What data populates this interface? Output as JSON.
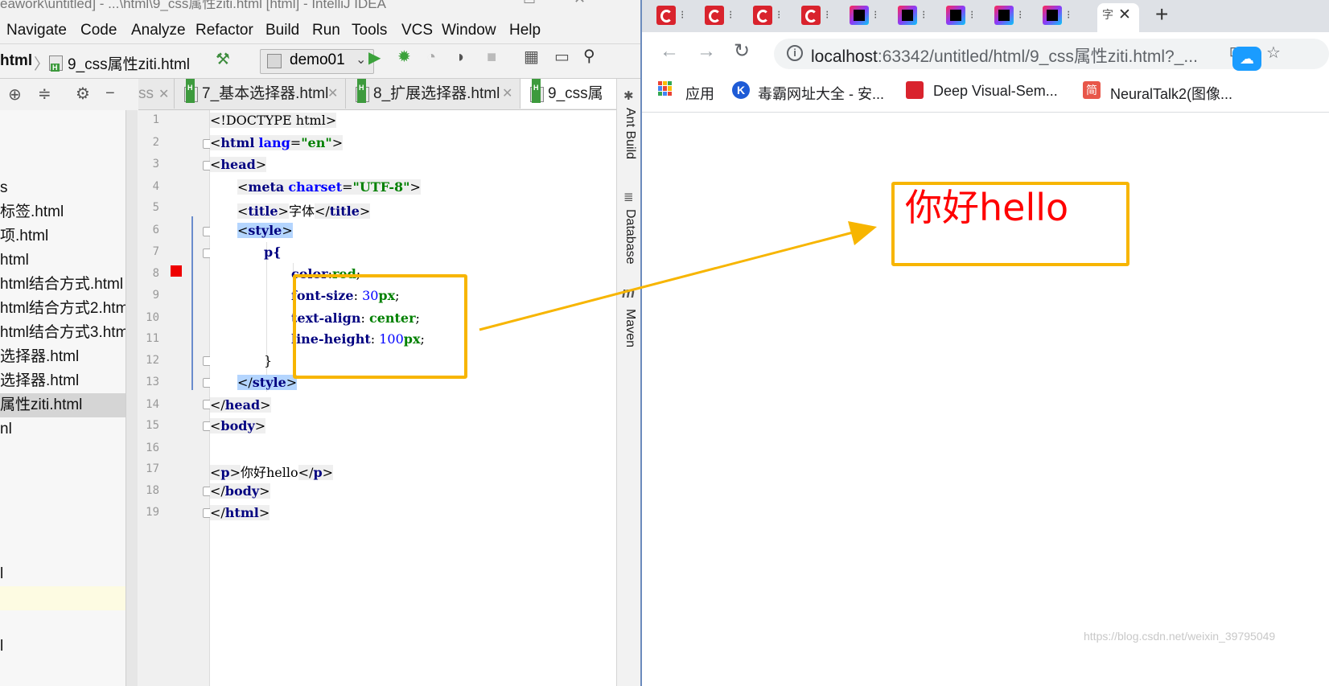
{
  "ide": {
    "title": "eawork\\untitled] - ...\\html\\9_css属性ziti.html [html] - IntelliJ IDEA",
    "menu": [
      "Navigate",
      "Code",
      "Analyze",
      "Refactor",
      "Build",
      "Run",
      "Tools",
      "VCS",
      "Window",
      "Help"
    ],
    "breadcrumb_root": "html",
    "breadcrumb_file": "9_css属性ziti.html",
    "run_config": "demo01",
    "project_items": [
      "s",
      "标签.html",
      "项.html",
      "html",
      "html结合方式.html",
      "html结合方式2.html",
      "html结合方式3.html",
      "选择器.html",
      "选择器.html",
      "属性ziti.html",
      "nl",
      "l",
      "l"
    ],
    "tabs": [
      {
        "label": "ss",
        "partial": true
      },
      {
        "label": "7_基本选择器.html"
      },
      {
        "label": "8_扩展选择器.html"
      },
      {
        "label": "9_css属"
      }
    ],
    "side_tools": [
      "Ant Build",
      "Database",
      "Maven"
    ],
    "line_numbers": [
      "1",
      "2",
      "3",
      "4",
      "5",
      "6",
      "7",
      "8",
      "9",
      "10",
      "11",
      "12",
      "13",
      "14",
      "15",
      "16",
      "17",
      "18",
      "19"
    ],
    "code": {
      "l1": "<!DOCTYPE html>",
      "l2_tag": "html",
      "l2_attr": "lang",
      "l2_val": "\"en\"",
      "l3_tag": "head",
      "l4_tag": "meta",
      "l4_attr": "charset",
      "l4_val": "\"UTF-8\"",
      "l5_tag": "title",
      "l5_text": "字体",
      "l6_tag": "style",
      "l7_sel": "p{",
      "l8_prop": "color",
      "l8_val": "red",
      "l9_prop": "font-size",
      "l9_num": "30",
      "l9_unit": "px",
      "l10_prop": "text-align",
      "l10_val": "center",
      "l11_prop": "line-height",
      "l11_num": "100",
      "l11_unit": "px",
      "l12": "}",
      "l13_tag": "style",
      "l14_tag": "head",
      "l15_tag": "body",
      "l17_tag": "p",
      "l17_text": "你好hello",
      "l18_tag": "body",
      "l19_tag": "html"
    }
  },
  "browser": {
    "url_host": "localhost",
    "url_rest": ":63342/untitled/html/9_css属性ziti.html?_...",
    "bookmarks": [
      "应用",
      "毒霸网址大全 - 安...",
      "Deep Visual-Sem...",
      "NeuralTalk2(图像..."
    ],
    "page_text": "你好hello",
    "new_tab_symbol": "+",
    "close_symbol": "✕"
  },
  "watermark": "https://blog.csdn.net/weixin_39795049",
  "colors": {
    "highlight_box": "#f7b500",
    "page_text": "#ff0000"
  }
}
